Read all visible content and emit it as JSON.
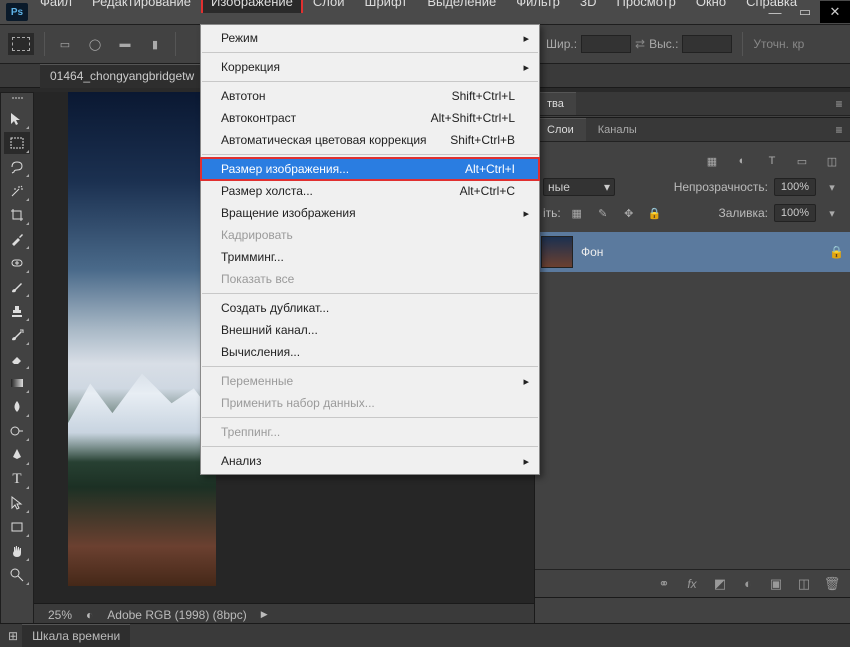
{
  "app": {
    "logo": "Ps"
  },
  "window_controls": {
    "minimize": "—",
    "maximize": "▭",
    "close": "✕"
  },
  "menubar": {
    "items": [
      "Файл",
      "Редактирование",
      "Изображение",
      "Слои",
      "Шрифт",
      "Выделение",
      "Фильтр",
      "3D",
      "Просмотр",
      "Окно",
      "Справка"
    ],
    "active_index": 2
  },
  "optionsbar": {
    "width_label": "Шир.:",
    "height_label": "Выс.:",
    "refine_label": "Уточн. кр"
  },
  "doctab": {
    "label": "01464_chongyangbridgetw"
  },
  "canvas_status": {
    "zoom": "25%",
    "profile": "Adobe RGB (1998) (8bpc)"
  },
  "dropdown": {
    "groups": [
      [
        {
          "label": "Режим",
          "arrow": true
        }
      ],
      [
        {
          "label": "Коррекция",
          "arrow": true
        }
      ],
      [
        {
          "label": "Автотон",
          "shortcut": "Shift+Ctrl+L"
        },
        {
          "label": "Автоконтраст",
          "shortcut": "Alt+Shift+Ctrl+L"
        },
        {
          "label": "Автоматическая цветовая коррекция",
          "shortcut": "Shift+Ctrl+B"
        }
      ],
      [
        {
          "label": "Размер изображения...",
          "shortcut": "Alt+Ctrl+I",
          "highlight": true,
          "frame": true
        },
        {
          "label": "Размер холста...",
          "shortcut": "Alt+Ctrl+C"
        },
        {
          "label": "Вращение изображения",
          "arrow": true
        },
        {
          "label": "Кадрировать",
          "disabled": true
        },
        {
          "label": "Тримминг..."
        },
        {
          "label": "Показать все",
          "disabled": true
        }
      ],
      [
        {
          "label": "Создать дубликат..."
        },
        {
          "label": "Внешний канал..."
        },
        {
          "label": "Вычисления..."
        }
      ],
      [
        {
          "label": "Переменные",
          "arrow": true,
          "disabled": true
        },
        {
          "label": "Применить набор данных...",
          "disabled": true
        }
      ],
      [
        {
          "label": "Треппинг...",
          "disabled": true
        }
      ],
      [
        {
          "label": "Анализ",
          "arrow": true
        }
      ]
    ]
  },
  "right_panels": {
    "panel1_tabs": [
      "тва"
    ],
    "layers_tabs": [
      "Слои",
      "Каналы"
    ],
    "layers": {
      "mode_value": "ные",
      "opacity_label": "Непрозрачность:",
      "opacity_value": "100%",
      "lock_label": "іть:",
      "fill_label": "Заливка:",
      "fill_value": "100%",
      "layer0": {
        "name": "Фон"
      }
    }
  },
  "statusbar": {
    "timeline_tab": "Шкала времени"
  },
  "tool_icons": [
    "move",
    "marquee",
    "lasso",
    "wand",
    "crop",
    "eyedropper",
    "heal",
    "brush",
    "stamp",
    "history",
    "eraser",
    "gradient",
    "blur",
    "dodge",
    "pen",
    "type",
    "arrow",
    "shape",
    "hand",
    "zoom"
  ],
  "colors": {
    "highlight_frame": "#e03030",
    "menu_highlight": "#2a7de1"
  }
}
